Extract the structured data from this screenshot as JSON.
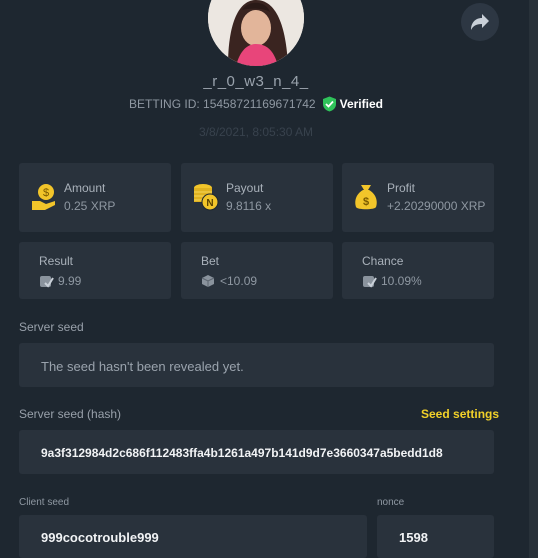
{
  "user": {
    "name": "_r_0_w3_n_4_",
    "betting_id_label": "BETTING ID: 15458721169671742",
    "verified_label": "Verified"
  },
  "bet_time": "3/8/2021, 8:05:30 AM",
  "stats": {
    "amount": {
      "label": "Amount",
      "value": "0.25 XRP"
    },
    "payout": {
      "label": "Payout",
      "value": "9.8116 x"
    },
    "profit": {
      "label": "Profit",
      "value": "+2.20290000 XRP"
    },
    "result": {
      "label": "Result",
      "value": "9.99"
    },
    "bet": {
      "label": "Bet",
      "value": "<10.09"
    },
    "chance": {
      "label": "Chance",
      "value": "10.09%"
    }
  },
  "server_seed": {
    "label": "Server seed",
    "value": "The seed hasn't been revealed yet."
  },
  "server_seed_hash": {
    "label": "Server seed (hash)",
    "settings_link": "Seed settings",
    "value": "9a3f312984d2c686f112483ffa4b1261a497b141d9d7e3660347a5bedd1d8"
  },
  "client_seed": {
    "label": "Client seed",
    "value": "999cocotrouble999"
  },
  "nonce": {
    "label": "nonce",
    "value": "1598"
  },
  "colors": {
    "background": "#1e2730",
    "card": "#29323c",
    "accent_yellow": "#f2d129",
    "verified_green": "#2fc35a"
  },
  "icons": {
    "share": "share-icon",
    "verified": "verified-shield-icon",
    "amount": "money-hand-icon",
    "payout": "coin-stack-icon",
    "profit": "money-bag-icon",
    "result": "dice-check-icon",
    "bet": "dice-icon",
    "chance": "dice-check-icon"
  }
}
